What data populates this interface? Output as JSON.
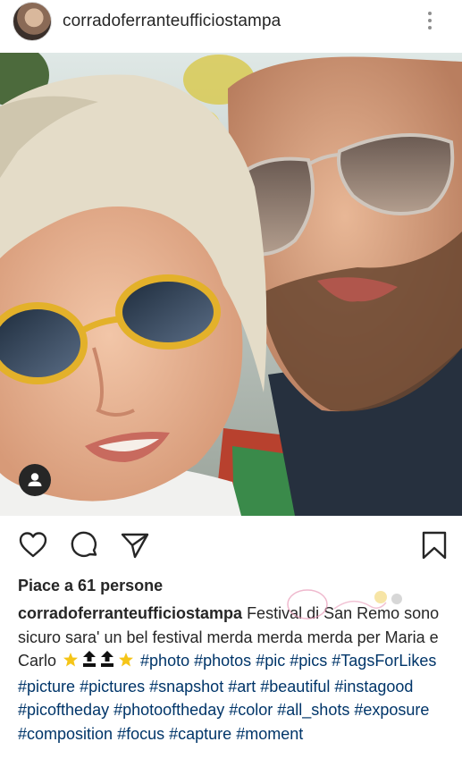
{
  "header": {
    "username": "corradoferranteufficiostampa"
  },
  "icons": {
    "more": "more-vertical-icon",
    "like": "heart-icon",
    "comment": "comment-icon",
    "share": "paper-plane-icon",
    "save": "bookmark-icon",
    "tag": "user-tag-icon"
  },
  "post": {
    "likes_text": "Piace a 61 persone",
    "caption": {
      "username": "corradoferranteufficiostampa",
      "text_line1": " Festival di San Remo sono sicuro sara' un bel festival merda merda merda per Maria e Carlo ",
      "hashtags": [
        "#photo",
        "#photos",
        "#pic",
        "#pics",
        "#TagsForLikes",
        "#picture",
        "#pictures",
        "#snapshot",
        "#art",
        "#beautiful",
        "#instagood",
        "#picoftheday",
        "#photooftheday",
        "#color",
        "#all_shots",
        "#exposure",
        "#composition",
        "#focus",
        "#capture",
        "#moment"
      ]
    }
  },
  "colors": {
    "text": "#262626",
    "hashtag": "#003569",
    "icon_gray": "#8e8e8e"
  }
}
